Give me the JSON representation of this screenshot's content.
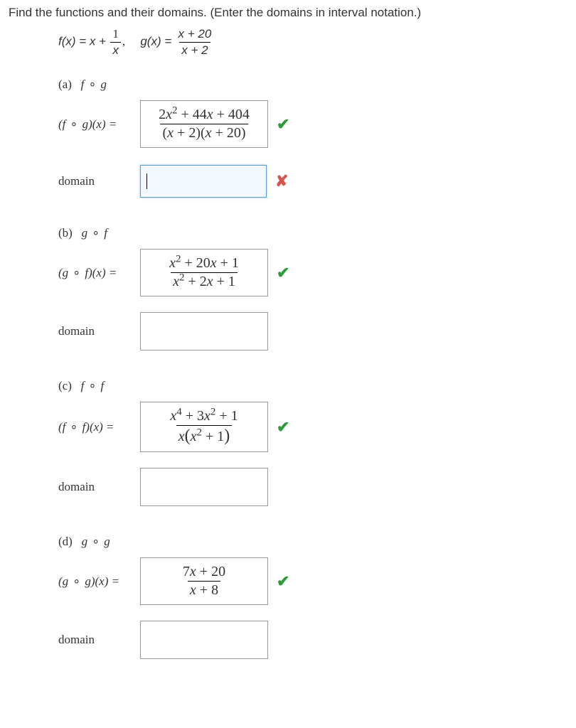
{
  "question": "Find the functions and their domains. (Enter the domains in interval notation.)",
  "formula": {
    "f_lhs": "f(x) = x +",
    "f_frac_num": "1",
    "f_frac_den": "x",
    "comma": ",",
    "g_lhs": "g(x) =",
    "g_frac_num": "x + 20",
    "g_frac_den": "x + 2"
  },
  "parts": {
    "a": {
      "label": "(a) f ∘ g",
      "lhs": "(f ∘ g)(x) =",
      "ans_num": "2x² + 44x + 404",
      "ans_den": "(x + 2)(x + 20)",
      "mark": "check",
      "domain_label": "domain",
      "domain_value": "",
      "domain_mark": "cross"
    },
    "b": {
      "label": "(b) g ∘ f",
      "lhs": "(g ∘ f)(x) =",
      "ans_num": "x² + 20x + 1",
      "ans_den": "x² + 2x + 1",
      "mark": "check",
      "domain_label": "domain",
      "domain_value": ""
    },
    "c": {
      "label": "(c) f ∘ f",
      "lhs": "(f ∘ f)(x) =",
      "ans_num": "x⁴ + 3x² + 1",
      "ans_den": "x(x² + 1)",
      "mark": "check",
      "domain_label": "domain",
      "domain_value": ""
    },
    "d": {
      "label": "(d) g ∘ g",
      "lhs": "(g ∘ g)(x) =",
      "ans_num": "7x + 20",
      "ans_den": "x + 8",
      "mark": "check",
      "domain_label": "domain",
      "domain_value": ""
    }
  }
}
